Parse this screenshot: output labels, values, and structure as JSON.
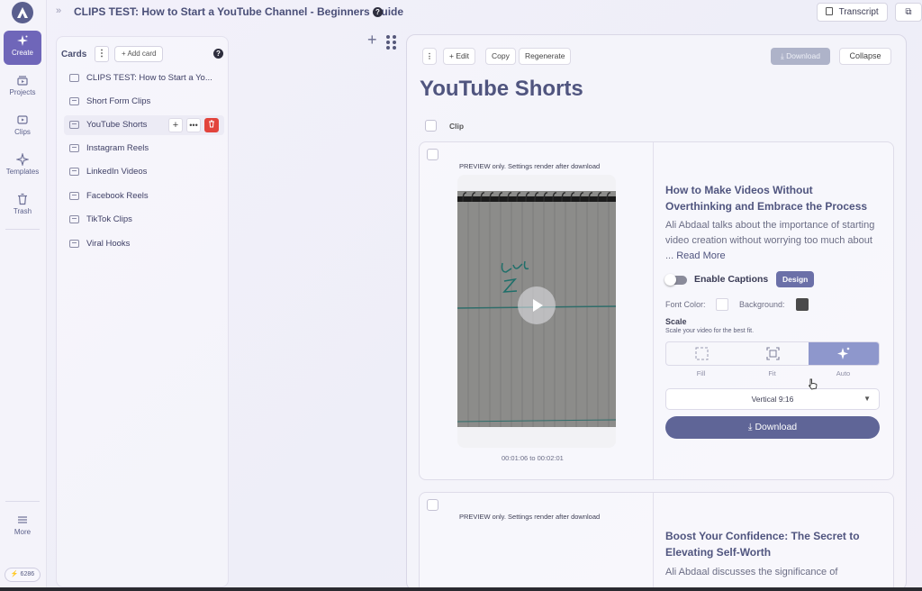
{
  "rail": {
    "items": [
      {
        "label": "Create",
        "icon": "sparkle-icon",
        "active": true
      },
      {
        "label": "Projects",
        "icon": "projects-icon"
      },
      {
        "label": "Clips",
        "icon": "clips-icon"
      },
      {
        "label": "Templates",
        "icon": "templates-icon"
      },
      {
        "label": "Trash",
        "icon": "trash-icon"
      }
    ],
    "more_label": "More",
    "credits": "6286"
  },
  "topbar": {
    "title": "CLIPS TEST: How to Start a YouTube Channel - Beginners Guide",
    "transcript_label": "Transcript"
  },
  "cards": {
    "heading": "Cards",
    "add_label": "Add card",
    "items": [
      {
        "label": "CLIPS TEST: How to Start a Yo..."
      },
      {
        "label": "Short Form Clips"
      },
      {
        "label": "YouTube Shorts"
      },
      {
        "label": "Instagram Reels"
      },
      {
        "label": "LinkedIn Videos"
      },
      {
        "label": "Facebook Reels"
      },
      {
        "label": "TikTok Clips"
      },
      {
        "label": "Viral Hooks"
      }
    ]
  },
  "main": {
    "edit_label": "Edit",
    "copy_label": "Copy",
    "regenerate_label": "Regenerate",
    "download_label": "Download",
    "collapse_label": "Collapse",
    "title": "YouTube Shorts",
    "clip_header": "Clip",
    "clips": [
      {
        "preview_note": "PREVIEW only. Settings render after download",
        "timecode": "00:01:06 to 00:02:01",
        "title": "How to Make Videos Without Overthinking and Embrace the Process",
        "desc": "Ali Abdaal talks about the importance of starting video creation without worrying too much about ...",
        "read_more": "Read More",
        "handwriting": "Level 2",
        "enable_captions": "Enable Captions",
        "design_label": "Design",
        "font_color_label": "Font Color:",
        "background_label": "Background:",
        "font_color": "#ffffff",
        "background_color": "#4a4a4a",
        "scale_label": "Scale",
        "scale_sub": "Scale your video for the best fit.",
        "scale_options": [
          "Fill",
          "Fit",
          "Auto"
        ],
        "scale_selected": "Auto",
        "aspect": "Vertical 9:16",
        "download_label": "Download"
      },
      {
        "preview_note": "PREVIEW only. Settings render after download",
        "title": "Boost Your Confidence: The Secret to Elevating Self-Worth",
        "desc": "Ali Abdaal discusses the significance of"
      }
    ]
  }
}
